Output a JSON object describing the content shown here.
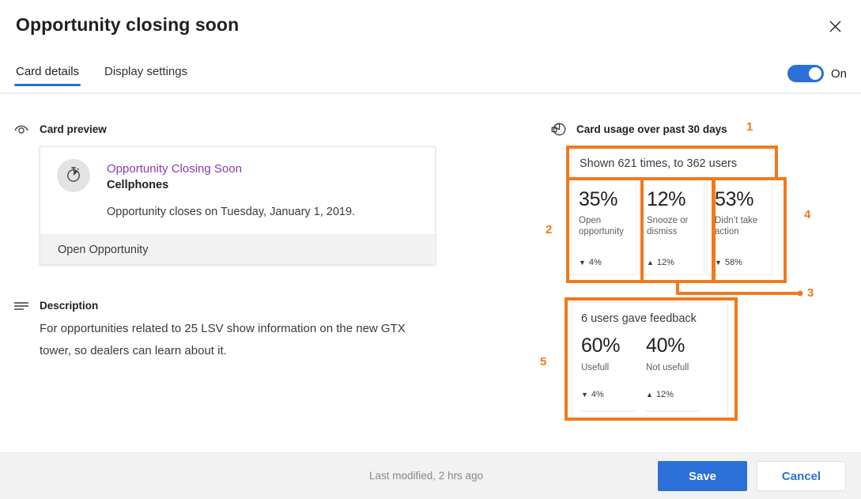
{
  "dialog": {
    "title": "Opportunity closing soon",
    "close_icon": "close-icon"
  },
  "tabs": [
    {
      "label": "Card details",
      "active": true
    },
    {
      "label": "Display settings",
      "active": false
    }
  ],
  "toggle": {
    "state_label": "On",
    "on": true,
    "accent": "#2b6fd8"
  },
  "left": {
    "card_preview": {
      "heading": "Card preview",
      "heading_icon": "eye-icon",
      "card": {
        "avatar_icon": "stopwatch-icon",
        "title": "Opportunity Closing Soon",
        "title_color": "#8a3ab0",
        "subtitle": "Cellphones",
        "body": "Opportunity closes on Tuesday, January 1, 2019.",
        "action_label": "Open Opportunity"
      }
    },
    "description": {
      "heading": "Description",
      "heading_icon": "lines-icon",
      "text": "For opportunities related to 25 LSV show information on the new GTX tower, so dealers can learn about it."
    }
  },
  "right": {
    "usage": {
      "heading": "Card usage over past 30 days",
      "heading_icon": "pie-chart-icon",
      "shown_summary": "Shown 621 times, to 362 users",
      "stats": [
        {
          "value": "35%",
          "label": "Open opportunity",
          "delta": "4%",
          "direction": "down",
          "arrow": "▼"
        },
        {
          "value": "12%",
          "label": "Snooze or dismiss",
          "delta": "12%",
          "direction": "up",
          "arrow": "▲"
        },
        {
          "value": "53%",
          "label": "Didn’t take action",
          "delta": "58%",
          "direction": "down",
          "arrow": "▼"
        }
      ]
    },
    "feedback": {
      "title": "6 users gave feedback",
      "items": [
        {
          "value": "60%",
          "label": "Usefull",
          "delta": "4%",
          "direction": "down",
          "arrow": "▼"
        },
        {
          "value": "40%",
          "label": "Not usefull",
          "delta": "12%",
          "direction": "up",
          "arrow": "▲"
        }
      ]
    }
  },
  "annotations": {
    "color": "#f2791c",
    "numbers": [
      {
        "id": "1",
        "label": "1"
      },
      {
        "id": "2",
        "label": "2"
      },
      {
        "id": "3",
        "label": "3"
      },
      {
        "id": "4",
        "label": "4"
      },
      {
        "id": "5",
        "label": "5"
      }
    ]
  },
  "footer": {
    "last_modified": "Last modified, 2 hrs ago",
    "save_label": "Save",
    "cancel_label": "Cancel"
  }
}
